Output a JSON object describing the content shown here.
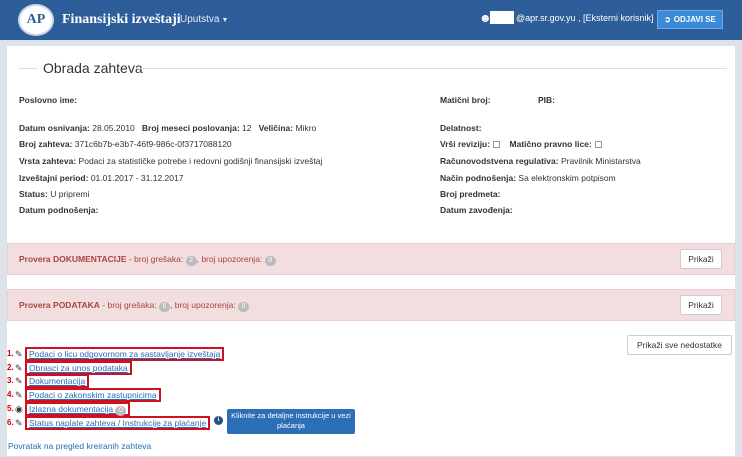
{
  "nav": {
    "logo": "AP",
    "brand": "Finansijski izveštaji",
    "menu": "Uputstva",
    "user_email": "@apr.sr.gov.yu , [Eksterni korisnik]",
    "logout": "ODJAVI SE"
  },
  "page_title": "Obrada zahteva",
  "fields": {
    "poslovno_ime": "Poslovno ime:",
    "maticni_broj": "Matični broj:",
    "pib": "PIB:",
    "datum_osnivanja_label": "Datum osnivanja:",
    "datum_osnivanja": "28.05.2010",
    "broj_meseci_label": "Broj meseci poslovanja:",
    "broj_meseci": "12",
    "velicina_label": "Veličina:",
    "velicina": "Mikro",
    "delatnost": "Delatnost:",
    "broj_zahteva_label": "Broj zahteva:",
    "broj_zahteva": "371c6b7b-e3b7-46f9-986c-0f3717088120",
    "vrsi_reviziju": "Vrši reviziju:",
    "maticno_pravno_lice": "Matično pravno lice:",
    "vrsta_zahteva_label": "Vrsta zahteva:",
    "vrsta_zahteva": "Podaci za statističke potrebe i redovni godišnji finansijski izveštaj",
    "racunovodstvena_label": "Računovodstvena regulativa:",
    "racunovodstvena": "Pravilnik Ministarstva",
    "izvestajni_period_label": "Izveštajni period:",
    "izvestajni_period": "01.01.2017 - 31.12.2017",
    "nacin_podnosenja_label": "Način podnošenja:",
    "nacin_podnosenja": "Sa elektronskim potpisom",
    "status_label": "Status:",
    "status": "U pripremi",
    "broj_predmeta": "Broj predmeta:",
    "datum_podnosenja": "Datum podnošenja:",
    "datum_zavodjenja": "Datum zavođenja:"
  },
  "alerts": [
    {
      "title": "Provera DOKUMENTACIJE",
      "errors_label": " - broj grešaka: ",
      "errors": "2",
      "warnings_label": ", broj upozorenja: ",
      "warnings": "0",
      "button": "Prikaži"
    },
    {
      "title": "Provera PODATAKA",
      "errors_label": " - broj grešaka: ",
      "errors": "6",
      "warnings_label": ", broj upozorenja: ",
      "warnings": "0",
      "button": "Prikaži"
    }
  ],
  "show_all_button": "Prikaži sve nedostatke",
  "links": [
    {
      "num": "1.",
      "label": "Podaci o licu odgovornom za sastavljanje izveštaja"
    },
    {
      "num": "2.",
      "label": "Obrasci za unos podataka"
    },
    {
      "num": "3.",
      "label": "Dokumentacija"
    },
    {
      "num": "4.",
      "label": "Podaci o zakonskim zastupnicima"
    },
    {
      "num": "5.",
      "label": "Izlazna dokumentacija",
      "badge": "0"
    },
    {
      "num": "6.",
      "label": "Status naplate zahteva / Instrukcije za plaćanje"
    }
  ],
  "tooltip": "Kliknite za detaljne instrukcije u vezi plaćanja",
  "back_link": "Povratak na pregled kreiranih zahteva"
}
